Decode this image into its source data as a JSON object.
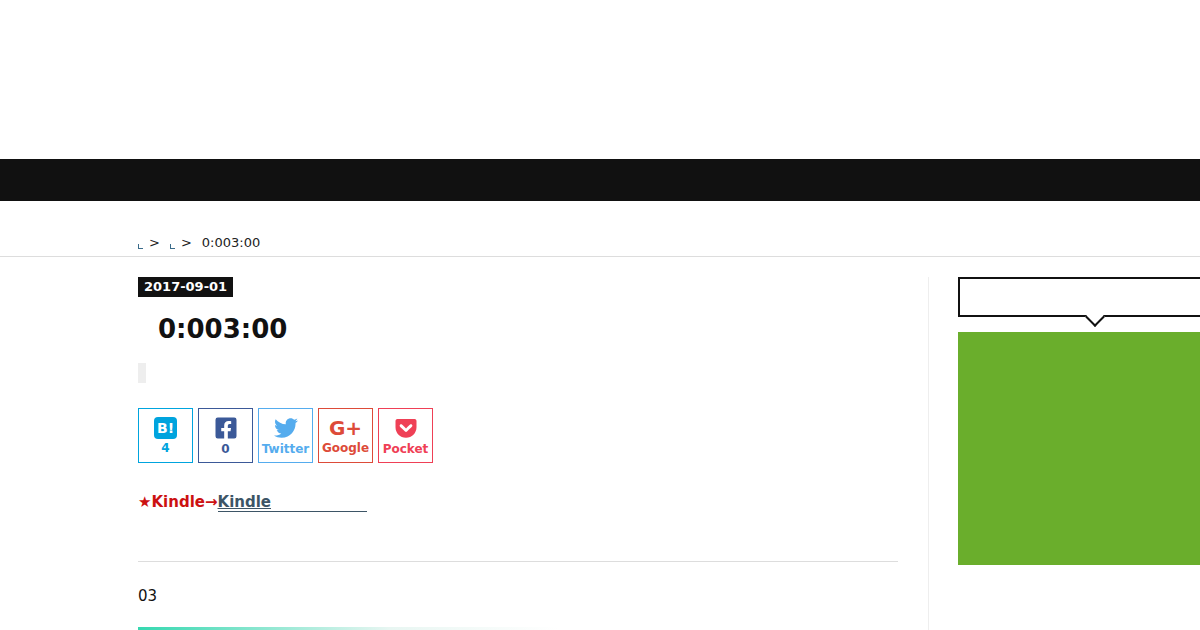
{
  "breadcrumb": {
    "links": [
      {
        "separator": ">"
      },
      {
        "separator": ">"
      }
    ],
    "current": "0:003:00"
  },
  "post": {
    "date": "2017-09-01",
    "title": "0:003:00"
  },
  "share_buttons": [
    {
      "kind": "hatena",
      "icon": "B!",
      "label": "4",
      "color": "#00a4de"
    },
    {
      "kind": "facebook",
      "icon": "",
      "label": "0",
      "color": "#3b5998"
    },
    {
      "kind": "twitter",
      "icon": "",
      "label": "Twitter",
      "color": "#55acee"
    },
    {
      "kind": "google",
      "icon": "G+",
      "label": "Google",
      "color": "#dd4b39"
    },
    {
      "kind": "pocket",
      "icon": "",
      "label": "Pocket",
      "color": "#ef4056"
    }
  ],
  "kindle": {
    "prefix": "★Kindle→",
    "link": "Kindle"
  },
  "body": {
    "text": "03"
  }
}
